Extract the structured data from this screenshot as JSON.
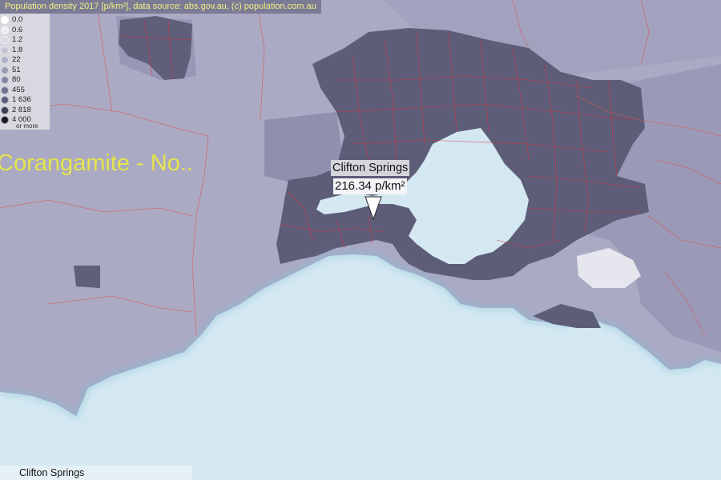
{
  "header": {
    "source_text": "Population density 2017 [p/km²], data source: abs.gov.au, (c) population.com.au"
  },
  "legend": {
    "items": [
      {
        "label": "0.0",
        "color": "#ffffff"
      },
      {
        "label": "0.6",
        "color": "#ececf2"
      },
      {
        "label": "1.2",
        "color": "#d9d9e4"
      },
      {
        "label": "1.8",
        "color": "#c3c3d5"
      },
      {
        "label": "22",
        "color": "#aeaec6"
      },
      {
        "label": "51",
        "color": "#9b9bb6"
      },
      {
        "label": "80",
        "color": "#8686a3"
      },
      {
        "label": "455",
        "color": "#6f6f8e"
      },
      {
        "label": "1 636",
        "color": "#5a5a79"
      },
      {
        "label": "2 818",
        "color": "#3d3d55"
      },
      {
        "label": "4 000",
        "color": "#1a1a24"
      }
    ],
    "more_label": "or more"
  },
  "map": {
    "region_label": "Corangamite - No..",
    "colors": {
      "water": "#d4e8f2",
      "rural": "#aaaac4",
      "suburban": "#8c8cac",
      "urban": "#5d5d78",
      "boundary": "#d43a3a"
    }
  },
  "callout": {
    "name": "Clifton Springs",
    "value": "216.34 p/km²"
  },
  "status": {
    "text": "Clifton Springs"
  }
}
